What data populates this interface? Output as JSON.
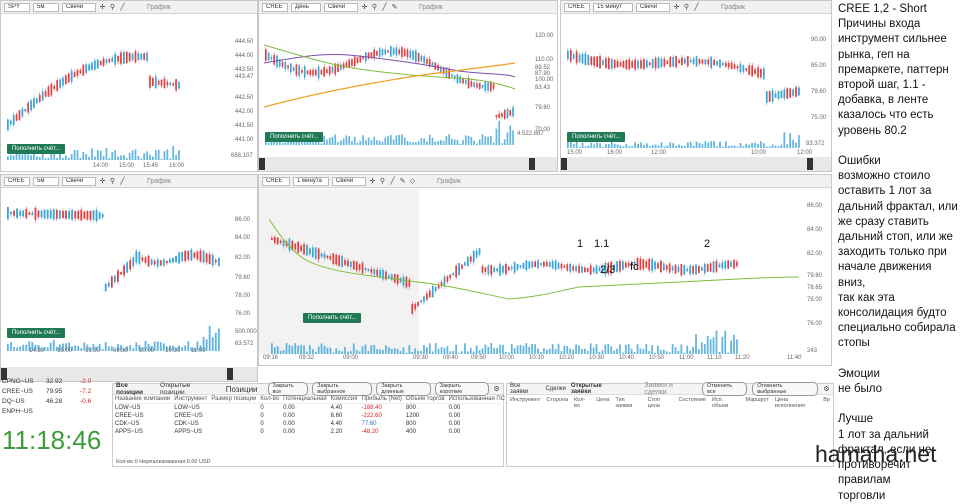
{
  "panels": {
    "p1": {
      "symbol": "SPY",
      "interval": "5м",
      "type": "Свечи",
      "graph_label": "График",
      "prices": [
        "444.50",
        "444.00",
        "443.50",
        "443.47",
        "442.50",
        "442.00",
        "441.50",
        "441.00"
      ],
      "times": [
        "14:00",
        "15:00",
        "15:45",
        "16:00"
      ],
      "vol_label": "688.107",
      "fill_btn": "Пополнить счёт..."
    },
    "p2": {
      "symbol": "CREE",
      "interval": "День",
      "type": "Свечи",
      "graph_label": "График",
      "prices": [
        "120.00",
        "110.00",
        "100.00",
        "89.52",
        "87.90",
        "83.43",
        "79.60",
        "70.00"
      ],
      "times": [],
      "vol_label": "4.522.887",
      "fill_btn": "Пополнить счёт..."
    },
    "p3": {
      "symbol": "CREE",
      "interval": "15 минут",
      "type": "Свечи",
      "graph_label": "График",
      "prices": [
        "90.00",
        "85.00",
        "80.00",
        "79.60",
        "75.00"
      ],
      "times": [
        "15:00",
        "16:00",
        "12:00",
        "10:00",
        "12:00"
      ],
      "vol_label": "83.372",
      "fill_btn": "Пополнить счёт..."
    },
    "p4": {
      "symbol": "CREE",
      "interval": "5м",
      "type": "Свечи",
      "graph_label": "График",
      "prices": [
        "86.00",
        "84.00",
        "82.00",
        "79.60",
        "78.00",
        "76.00",
        "500.000",
        "63.572"
      ],
      "times": [
        "14:30",
        "15:00",
        "15:30",
        "09:30",
        "10:00",
        "10:30",
        "11:00"
      ],
      "fill_btn": "Пополнить счёт..."
    },
    "p5": {
      "symbol": "CREE",
      "interval": "1 минута",
      "type": "Свечи",
      "graph_label": "График",
      "prices": [
        "86.00",
        "84.00",
        "82.00",
        "79.60",
        "78.65",
        "78.00",
        "76.00"
      ],
      "times": [
        "09:16",
        "09:32",
        "09:00",
        "09:30",
        "09:40",
        "09:50",
        "10:00",
        "10:10",
        "10:20",
        "10:30",
        "10:40",
        "10:50",
        "11:00",
        "11:10",
        "11:20",
        "11:40"
      ],
      "vol_label": "243",
      "fill_btn": "Пополнить счёт..."
    }
  },
  "marks": {
    "m1": "1",
    "m11": "1.1",
    "m23": "2/3",
    "mfc": "fc",
    "m2": "2"
  },
  "notes": [
    "CREE 1,2 - Short",
    "Причины входа",
    "инструмент сильнее",
    "рынка, геп на",
    "премаркете, паттерн",
    "второй шаг, 1.1 -",
    "добавка, в ленте",
    "казалось что есть",
    "уровень 80.2",
    "",
    "Ошибки",
    "возможно стоило",
    "оставить 1 лот за",
    "дальний фрактал, или",
    "же сразу ставить",
    "дальний стоп, или же",
    "заходить только при",
    "начале движения вниз,",
    "так как эта",
    "консолидация будто",
    "специально собирала",
    "стопы",
    "",
    "Эмоции",
    "не было",
    "",
    "Лучше",
    "1 лот за дальний",
    "фрактал, если не",
    "противоречит правилам",
    "торговли"
  ],
  "watchlist": [
    {
      "sym": "CPNG~US",
      "price": "32.92",
      "chg": "-2.0"
    },
    {
      "sym": "CREE~US",
      "price": "79.95",
      "chg": "-7.2"
    },
    {
      "sym": "DQ~US",
      "price": "46.28",
      "chg": "-0.6"
    },
    {
      "sym": "ENPH~US",
      "price": "",
      "chg": ""
    }
  ],
  "clock": "11:18:46",
  "positions": {
    "tab_all": "Все позиции",
    "tab_open": "Открытые позиции",
    "title": "Позиции",
    "btn_close_all": "Закрыть все",
    "btn_close_sel": "Закрыть выбранное",
    "btn_close_long": "Закрыть длинные",
    "btn_close_short": "Закрыть короткие",
    "headers": [
      "Название компании",
      "Инструмент",
      "Размер позиции",
      "Кол-во",
      "Потенциальная",
      "Комиссия",
      "Прибыль (Net)",
      "Объем торгов",
      "Использованная ПС"
    ],
    "rows": [
      [
        "LOW~US",
        "LOW~US",
        "",
        "0",
        "0.00",
        "4.40",
        "-188.40",
        "800",
        "0.00"
      ],
      [
        "CREE~US",
        "CREE~US",
        "",
        "0",
        "0.00",
        "6.60",
        "-222.60",
        "1200",
        "0.00"
      ],
      [
        "CDK~US",
        "CDK~US",
        "",
        "0",
        "0.00",
        "4.40",
        "77.60",
        "800",
        "0.00"
      ],
      [
        "APPS~US",
        "APPS~US",
        "",
        "0",
        "0.00",
        "2.20",
        "-48.20",
        "400",
        "0.00"
      ]
    ],
    "footer": "Кол-во 0   Нереализованная 0.00 USD"
  },
  "orders": {
    "tab_all": "Все заявки",
    "tab_deals": "Сделки",
    "tab_open": "Открытые заявки",
    "title": "Заявки и сделки",
    "btn_cancel_all": "Отменить все",
    "btn_cancel_sel": "Отменить выбранные",
    "headers": [
      "Инструмент",
      "Сторона",
      "Кол-во",
      "Цена",
      "Тип заявки",
      "Стоп цена",
      "Состояние",
      "Исп. объем",
      "Маршрут",
      "Цена исполнения",
      "Вр"
    ]
  },
  "watermark": "hamaha.net",
  "colors": {
    "up": "#3aa3d8",
    "down": "#e04040",
    "ma_green": "#7cbf3a",
    "ma_purple": "#7a4fb0",
    "ma_orange": "#f0a020",
    "btn": "#1f7a55"
  }
}
